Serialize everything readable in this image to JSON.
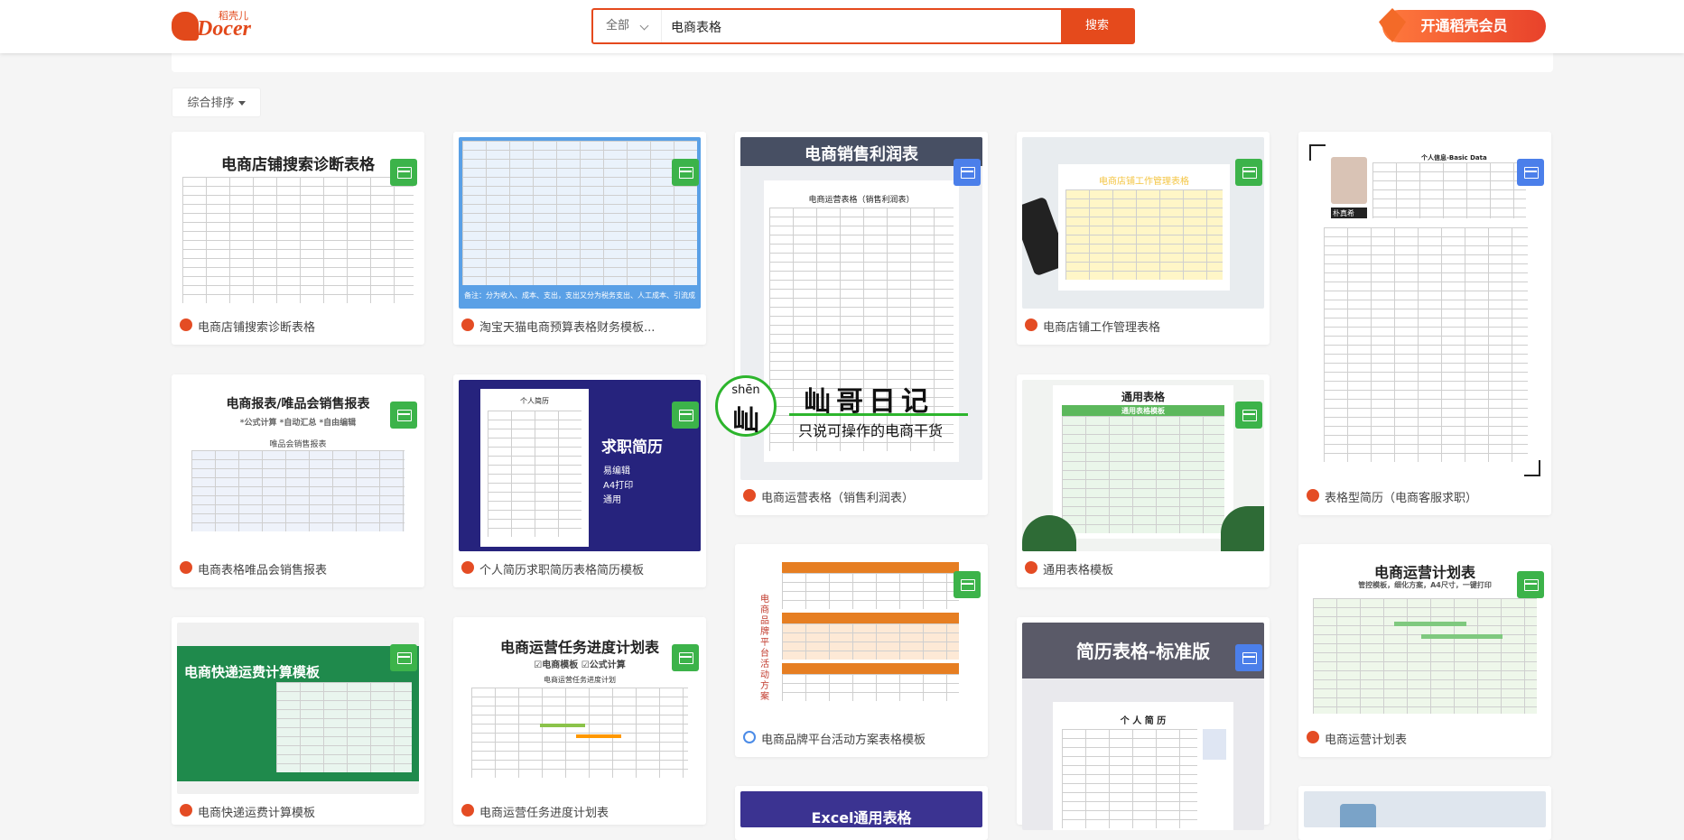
{
  "header": {
    "logo_text": "Docer",
    "logo_sub": "稻壳儿",
    "search_category": "全部",
    "search_query": "电商表格",
    "search_button": "搜索",
    "vip_button": "开通稻壳会员"
  },
  "toolbar": {
    "sort_label": "综合排序"
  },
  "cards": [
    {
      "title": "电商店铺搜索诊断表格",
      "thumb_title": "电商店铺搜索诊断表格"
    },
    {
      "title": "淘宝天猫电商预算表格财务模板...",
      "thumb_caption": "备注：分为收入、成本、支出，支出又分为税务支出、人工成本、引流成本。"
    },
    {
      "title": "电商运营表格（销售利润表）",
      "thumb_title": "电商销售利润表",
      "thumb_sub": "电商运营表格（销售利润表）"
    },
    {
      "title": "电商店铺工作管理表格",
      "thumb_title": "电商店铺工作管理表格"
    },
    {
      "title": "表格型简历（电商客服求职）",
      "thumb_title": "个人信息-Basic Data",
      "thumb_name": "朴真希"
    },
    {
      "title": "电商表格唯品会销售报表",
      "thumb_title": "电商报表/唯品会销售报表",
      "thumb_sub": "*公式计算 *自动汇总 *自由编辑",
      "thumb_table": "唯品会销售报表"
    },
    {
      "title": "个人简历求职简历表格简历模板",
      "thumb_title": "求职简历",
      "thumb_lines": [
        "易编辑",
        "A4打印",
        "通用"
      ],
      "thumb_doc": "个人简历"
    },
    {
      "title": "通用表格模板",
      "thumb_title": "通用表格",
      "thumb_sub": "通用表格模板"
    },
    {
      "title": "电商品牌平台活动方案表格模板",
      "thumb_side": "电商品牌平台活动方案"
    },
    {
      "title": "电商运营计划表",
      "thumb_title": "电商运营计划表",
      "thumb_sub": "管控模板，细化方案，A4尺寸，一键打印"
    },
    {
      "title": "电商快递运费计算模板",
      "thumb_title": "电商快递运费计算模板"
    },
    {
      "title": "电商运营任务进度计划表",
      "thumb_title": "电商运营任务进度计划表",
      "thumb_sub": "☑电商模板  ☑公式计算",
      "thumb_table": "电商运营任务进度计划"
    },
    {
      "title": "",
      "thumb_title": "简历表格-标准版",
      "thumb_doc": "个 人 简 历"
    },
    {
      "title": "",
      "thumb_title": "Excel通用表格"
    }
  ],
  "watermark": {
    "pinyin": "shēn",
    "char": "屾",
    "name": "屾哥日记",
    "slogan": "只说可操作的电商干货"
  },
  "colors": {
    "brand": "#e54a1c",
    "sheet_badge": "#3cb34a",
    "doc_badge": "#4b7fea"
  }
}
